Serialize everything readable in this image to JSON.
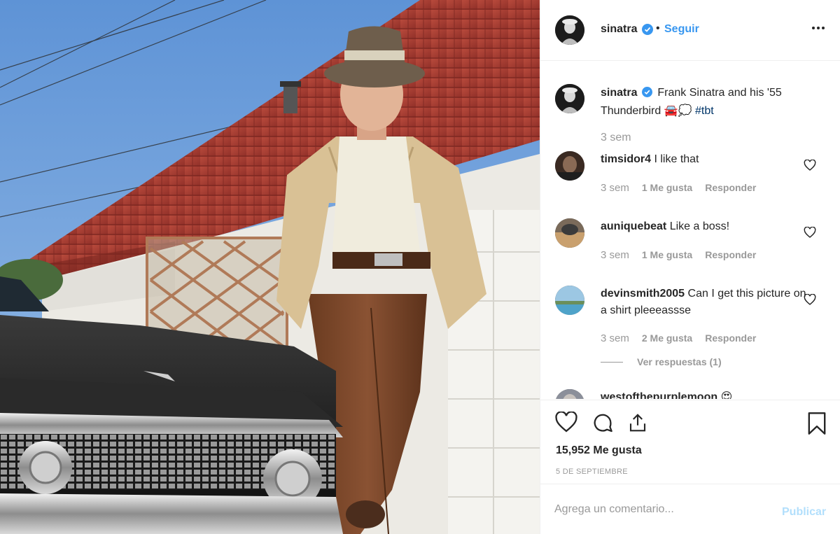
{
  "post": {
    "image_alt": "Frank Sinatra leaning on his '55 Thunderbird",
    "username": "sinatra",
    "verified": true,
    "separator": "•",
    "follow_label": "Seguir",
    "more_icon": "more-options-icon"
  },
  "caption": {
    "username": "sinatra",
    "text": "Frank Sinatra and his '55 Thunderbird 🚘💭",
    "hashtag": "#tbt",
    "time": "3 sem"
  },
  "comments": [
    {
      "username": "timsidor4",
      "text": "I like that",
      "time": "3 sem",
      "likes": "1 Me gusta",
      "reply": "Responder"
    },
    {
      "username": "auniquebeat",
      "text": "Like a boss!",
      "time": "3 sem",
      "likes": "1 Me gusta",
      "reply": "Responder"
    },
    {
      "username": "devinsmith2005",
      "text": "Can I get this picture on a shirt pleeeassse",
      "time": "3 sem",
      "likes": "2 Me gusta",
      "reply": "Responder",
      "view_replies": "Ver respuestas (1)"
    },
    {
      "username": "westofthepurplemoon",
      "text": "😍"
    }
  ],
  "actions": {
    "like_icon": "heart-icon",
    "comment_icon": "comment-icon",
    "share_icon": "share-icon",
    "save_icon": "bookmark-icon"
  },
  "likes_count": "15,952 Me gusta",
  "date": "5 DE SEPTIEMBRE",
  "add_comment": {
    "placeholder": "Agrega un comentario...",
    "publish_label": "Publicar"
  },
  "colors": {
    "link": "#3897f0",
    "hashtag": "#003569",
    "muted": "#999999",
    "publish_disabled": "#b2dffc",
    "verified_badge": "#3897f0"
  }
}
